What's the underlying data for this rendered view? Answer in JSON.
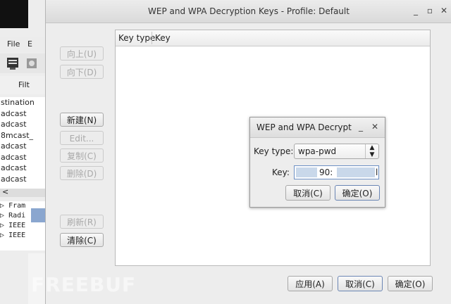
{
  "background_window": {
    "menu": {
      "file": "File",
      "edit_fragment": "E"
    },
    "filter_label": "Filt",
    "list_items": [
      "stination",
      "adcast",
      "adcast",
      "8mcast_",
      "adcast",
      "adcast",
      "adcast",
      "adcast"
    ],
    "scroll_left": "<",
    "tree_items": [
      "Fram",
      "Radi",
      "IEEE",
      "IEEE"
    ]
  },
  "main_dialog": {
    "title": "WEP and WPA Decryption Keys - Profile: Default",
    "window_controls": {
      "minimize": "_",
      "maximize": "▫",
      "close": "✕"
    },
    "buttons": {
      "move_up": "向上(U)",
      "move_down": "向下(D)",
      "new": "新建(N)",
      "edit": "Edit...",
      "copy": "复制(C)",
      "delete": "删除(D)",
      "refresh": "刷新(R)",
      "clear": "清除(C)",
      "apply": "应用(A)",
      "cancel": "取消(C)",
      "ok": "确定(O)"
    },
    "table": {
      "columns": [
        "Key type",
        "Key"
      ]
    }
  },
  "key_dialog": {
    "title": "WEP and WPA Decrypt",
    "window_controls": {
      "minimize": "_",
      "close": "✕"
    },
    "key_type_label": "Key type:",
    "key_type_value": "wpa-pwd",
    "key_label": "Key:",
    "key_value_visible": "90:",
    "key_value_tail": "l",
    "cancel": "取消(C)",
    "ok": "确定(O)"
  },
  "watermark": "FREEBUF"
}
